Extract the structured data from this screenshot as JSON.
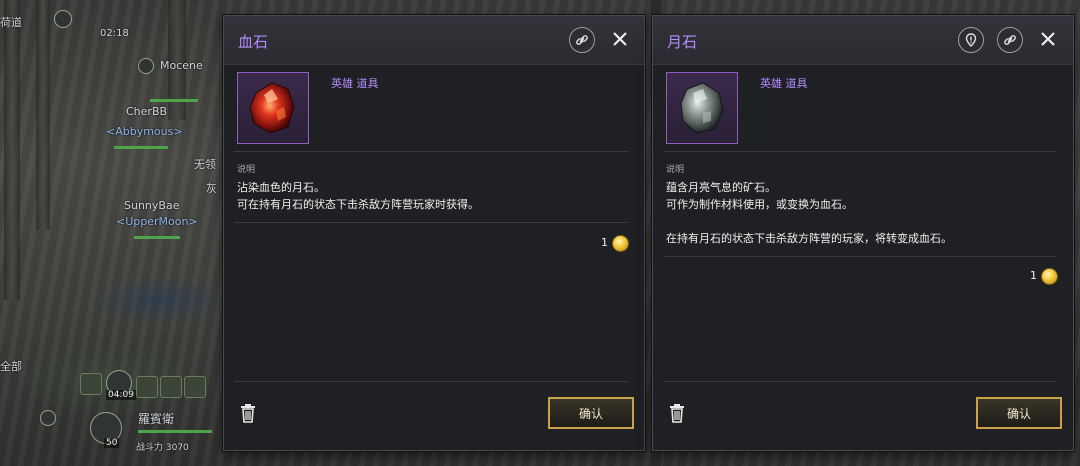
{
  "hud": {
    "clock": "02:18",
    "place": "荷道",
    "players": [
      {
        "name": "Mocene"
      },
      {
        "name": "CherBB",
        "guild": "<Abbymous>"
      },
      {
        "name": "SunnyBae",
        "guild": "<UpperMoon>"
      }
    ],
    "side_labels": [
      "无领",
      "灰"
    ],
    "map_label": "全部",
    "buff_timer": "04:09",
    "npc_name": "羅賓衛",
    "level": "50",
    "combat_power": "战斗力 3070"
  },
  "panels": [
    {
      "title": "血石",
      "grade": "英雄 道具",
      "desc_label": "说明",
      "desc_lines": [
        "沾染血色的月石。",
        "可在持有月石的状态下击杀敌方阵营玩家时获得。"
      ],
      "quantity": "1",
      "confirm_label": "确认",
      "image": "red-crystal-icon"
    },
    {
      "title": "月石",
      "grade": "英雄 道具",
      "desc_label": "说明",
      "desc_lines": [
        "蕴含月亮气息的矿石。",
        "可作为制作材料使用，或变换为血石。",
        "",
        "在持有月石的状态下击杀敌方阵营的玩家，将转变成血石。"
      ],
      "quantity": "1",
      "confirm_label": "确认",
      "image": "grey-ore-icon"
    }
  ],
  "colors": {
    "title": "#b38cff",
    "grade": "#b38cff",
    "panel_bg": "#1f2023",
    "confirm_border": "#c9a24a"
  }
}
